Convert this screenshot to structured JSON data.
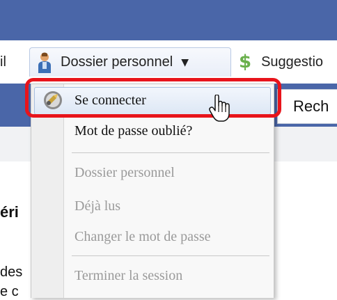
{
  "nav": {
    "partial_item": "il",
    "active_item": "Dossier personnel",
    "suggestions": "Suggestio"
  },
  "search": {
    "label": "Rech"
  },
  "content": {
    "frag1": "éri",
    "frag2": "des",
    "frag3": "e c"
  },
  "menu": {
    "login": "Se connecter",
    "forgot": "Mot de passe oublié?",
    "profile": "Dossier personnel",
    "read": "Déjà lus",
    "change_password": "Changer le mot de passe",
    "logout": "Terminer la session"
  },
  "colors": {
    "brand_blue": "#4a66a8",
    "highlight_red": "#e8141b",
    "disabled_text": "#9a9a9a",
    "dollar_green": "#6ab04c"
  },
  "icons": {
    "person": "person-icon",
    "dollar": "dollar-icon",
    "caret": "caret-down-icon",
    "login": "login-icon",
    "cursor": "hand-cursor-icon"
  }
}
